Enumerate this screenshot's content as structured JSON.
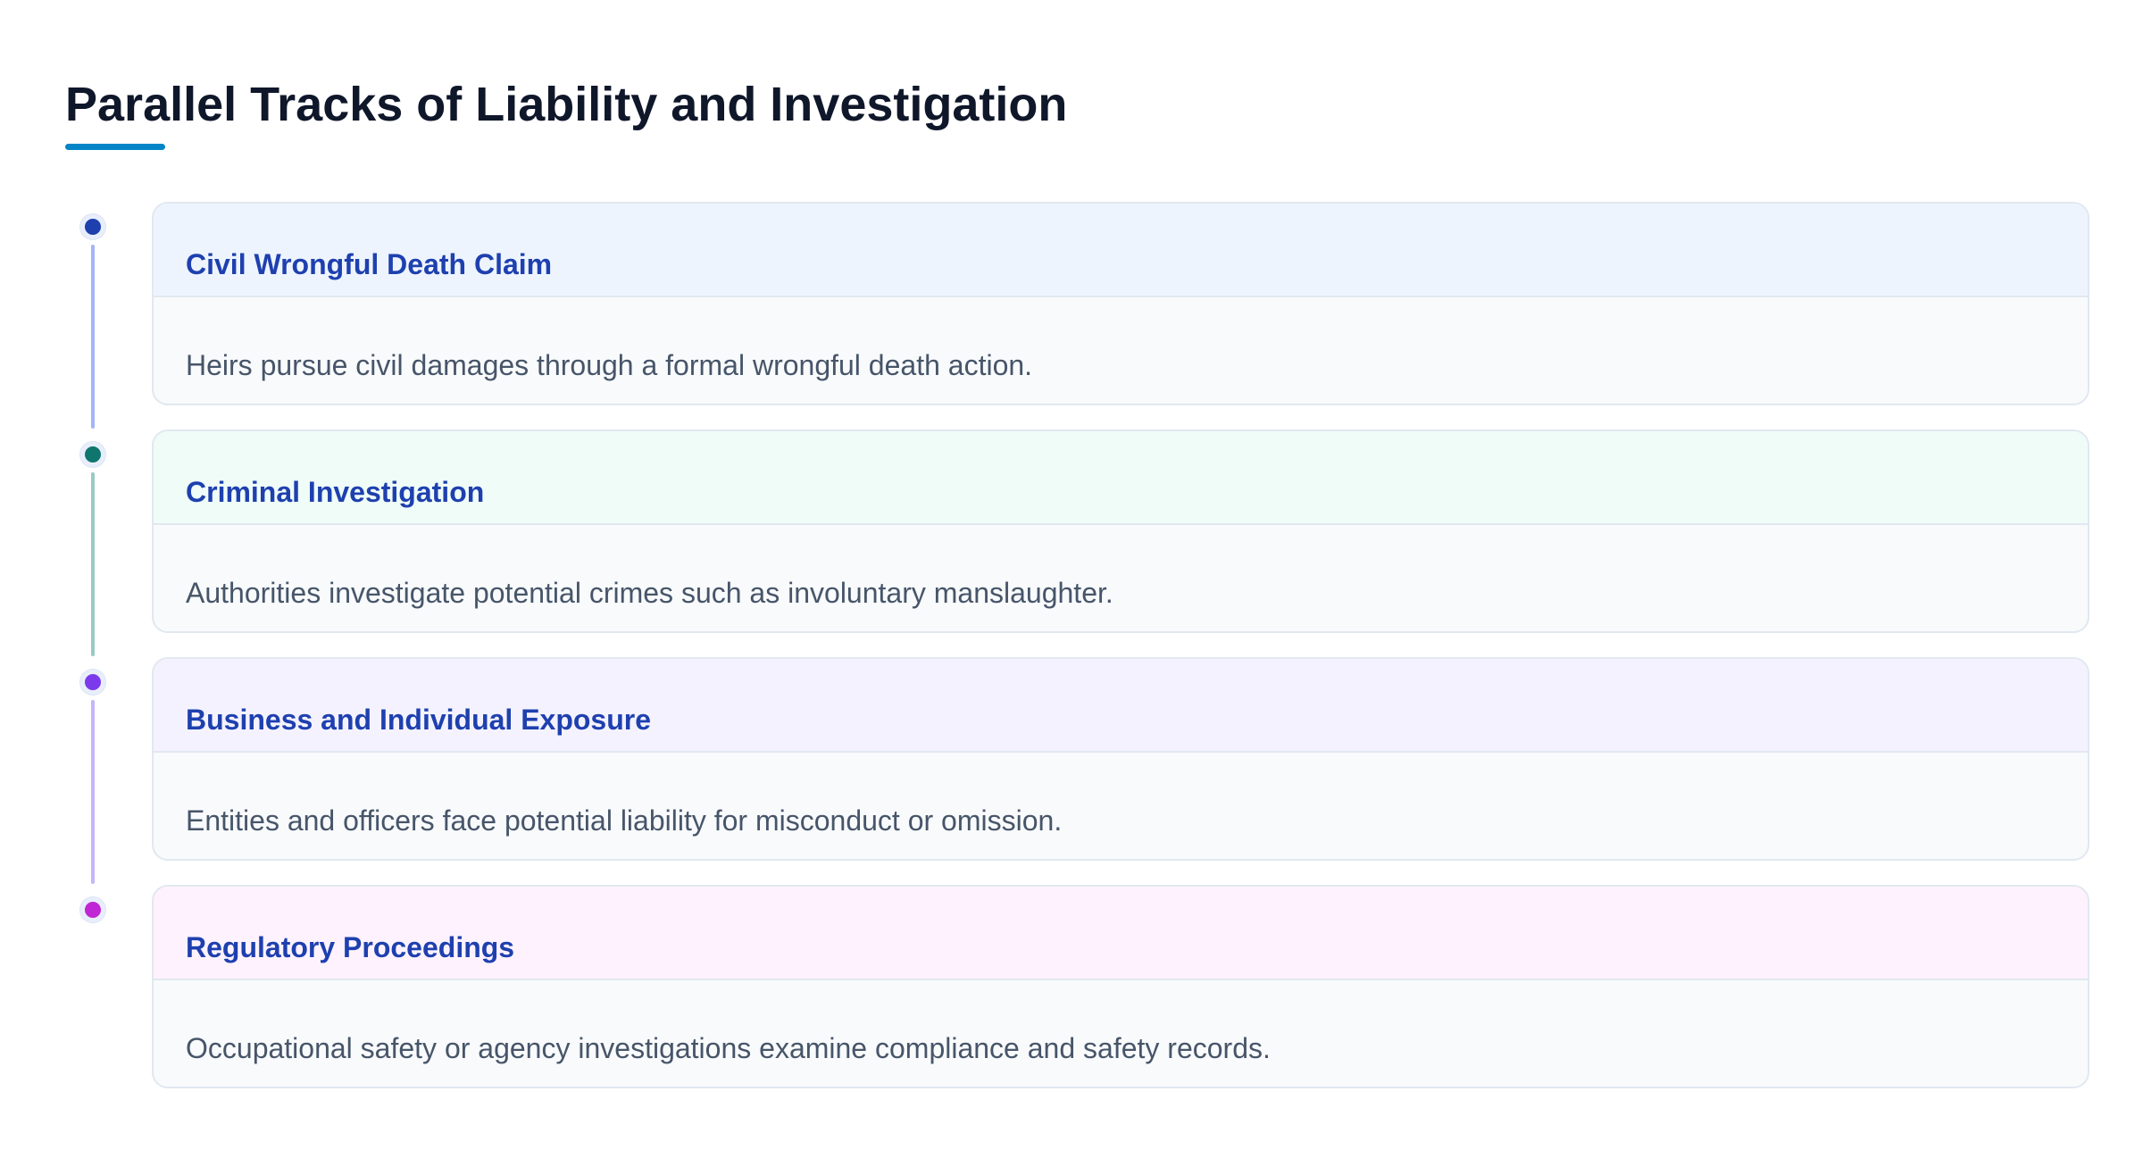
{
  "title": "Parallel Tracks of Liability and Investigation",
  "colors": {
    "title": "#0f172a",
    "accent_underline": "#0284c7",
    "card_title": "#1e40af",
    "card_text": "#475569",
    "card_border": "#e2e8f0",
    "card_body_bg": "#f8fafc"
  },
  "steps": [
    {
      "title": "Civil Wrongful Death Claim",
      "description": "Heirs pursue civil damages through a formal wrongful death action.",
      "dot_color": "#1e40af",
      "line_color": "#a5b4fc",
      "header_bg": "#eef4fe"
    },
    {
      "title": "Criminal Investigation",
      "description": "Authorities investigate potential crimes such as involuntary manslaughter.",
      "dot_color": "#0f766e",
      "line_color": "#99c9c2",
      "header_bg": "#effcf8"
    },
    {
      "title": "Business and Individual Exposure",
      "description": "Entities and officers face potential liability for misconduct or omission.",
      "dot_color": "#7c3aed",
      "line_color": "#c4b5fd",
      "header_bg": "#f4f2fe"
    },
    {
      "title": "Regulatory Proceedings",
      "description": "Occupational safety or agency investigations examine compliance and safety records.",
      "dot_color": "#c026d3",
      "line_color": "",
      "header_bg": "#fdf2fd"
    }
  ]
}
